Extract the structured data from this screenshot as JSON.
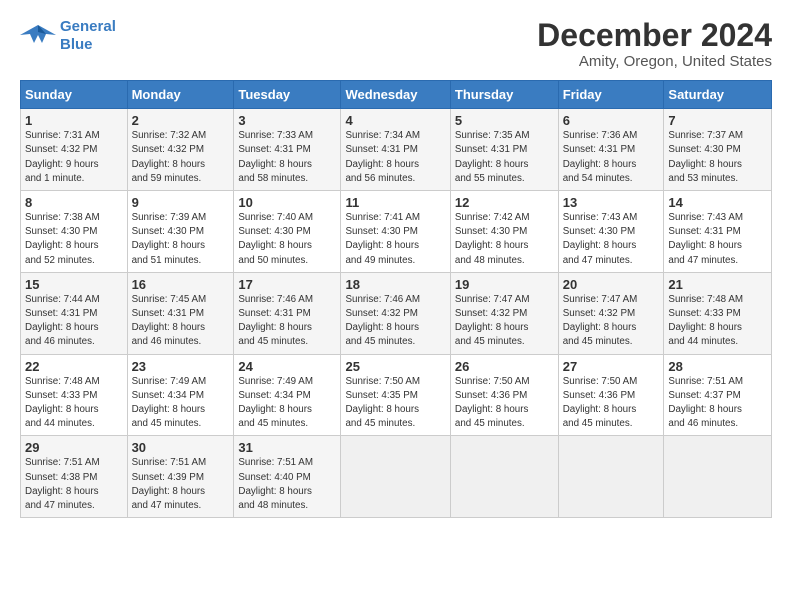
{
  "logo": {
    "line1": "General",
    "line2": "Blue"
  },
  "title": "December 2024",
  "subtitle": "Amity, Oregon, United States",
  "days_of_week": [
    "Sunday",
    "Monday",
    "Tuesday",
    "Wednesday",
    "Thursday",
    "Friday",
    "Saturday"
  ],
  "weeks": [
    [
      {
        "day": 1,
        "info": "Sunrise: 7:31 AM\nSunset: 4:32 PM\nDaylight: 9 hours\nand 1 minute."
      },
      {
        "day": 2,
        "info": "Sunrise: 7:32 AM\nSunset: 4:32 PM\nDaylight: 8 hours\nand 59 minutes."
      },
      {
        "day": 3,
        "info": "Sunrise: 7:33 AM\nSunset: 4:31 PM\nDaylight: 8 hours\nand 58 minutes."
      },
      {
        "day": 4,
        "info": "Sunrise: 7:34 AM\nSunset: 4:31 PM\nDaylight: 8 hours\nand 56 minutes."
      },
      {
        "day": 5,
        "info": "Sunrise: 7:35 AM\nSunset: 4:31 PM\nDaylight: 8 hours\nand 55 minutes."
      },
      {
        "day": 6,
        "info": "Sunrise: 7:36 AM\nSunset: 4:31 PM\nDaylight: 8 hours\nand 54 minutes."
      },
      {
        "day": 7,
        "info": "Sunrise: 7:37 AM\nSunset: 4:30 PM\nDaylight: 8 hours\nand 53 minutes."
      }
    ],
    [
      {
        "day": 8,
        "info": "Sunrise: 7:38 AM\nSunset: 4:30 PM\nDaylight: 8 hours\nand 52 minutes."
      },
      {
        "day": 9,
        "info": "Sunrise: 7:39 AM\nSunset: 4:30 PM\nDaylight: 8 hours\nand 51 minutes."
      },
      {
        "day": 10,
        "info": "Sunrise: 7:40 AM\nSunset: 4:30 PM\nDaylight: 8 hours\nand 50 minutes."
      },
      {
        "day": 11,
        "info": "Sunrise: 7:41 AM\nSunset: 4:30 PM\nDaylight: 8 hours\nand 49 minutes."
      },
      {
        "day": 12,
        "info": "Sunrise: 7:42 AM\nSunset: 4:30 PM\nDaylight: 8 hours\nand 48 minutes."
      },
      {
        "day": 13,
        "info": "Sunrise: 7:43 AM\nSunset: 4:30 PM\nDaylight: 8 hours\nand 47 minutes."
      },
      {
        "day": 14,
        "info": "Sunrise: 7:43 AM\nSunset: 4:31 PM\nDaylight: 8 hours\nand 47 minutes."
      }
    ],
    [
      {
        "day": 15,
        "info": "Sunrise: 7:44 AM\nSunset: 4:31 PM\nDaylight: 8 hours\nand 46 minutes."
      },
      {
        "day": 16,
        "info": "Sunrise: 7:45 AM\nSunset: 4:31 PM\nDaylight: 8 hours\nand 46 minutes."
      },
      {
        "day": 17,
        "info": "Sunrise: 7:46 AM\nSunset: 4:31 PM\nDaylight: 8 hours\nand 45 minutes."
      },
      {
        "day": 18,
        "info": "Sunrise: 7:46 AM\nSunset: 4:32 PM\nDaylight: 8 hours\nand 45 minutes."
      },
      {
        "day": 19,
        "info": "Sunrise: 7:47 AM\nSunset: 4:32 PM\nDaylight: 8 hours\nand 45 minutes."
      },
      {
        "day": 20,
        "info": "Sunrise: 7:47 AM\nSunset: 4:32 PM\nDaylight: 8 hours\nand 45 minutes."
      },
      {
        "day": 21,
        "info": "Sunrise: 7:48 AM\nSunset: 4:33 PM\nDaylight: 8 hours\nand 44 minutes."
      }
    ],
    [
      {
        "day": 22,
        "info": "Sunrise: 7:48 AM\nSunset: 4:33 PM\nDaylight: 8 hours\nand 44 minutes."
      },
      {
        "day": 23,
        "info": "Sunrise: 7:49 AM\nSunset: 4:34 PM\nDaylight: 8 hours\nand 45 minutes."
      },
      {
        "day": 24,
        "info": "Sunrise: 7:49 AM\nSunset: 4:34 PM\nDaylight: 8 hours\nand 45 minutes."
      },
      {
        "day": 25,
        "info": "Sunrise: 7:50 AM\nSunset: 4:35 PM\nDaylight: 8 hours\nand 45 minutes."
      },
      {
        "day": 26,
        "info": "Sunrise: 7:50 AM\nSunset: 4:36 PM\nDaylight: 8 hours\nand 45 minutes."
      },
      {
        "day": 27,
        "info": "Sunrise: 7:50 AM\nSunset: 4:36 PM\nDaylight: 8 hours\nand 45 minutes."
      },
      {
        "day": 28,
        "info": "Sunrise: 7:51 AM\nSunset: 4:37 PM\nDaylight: 8 hours\nand 46 minutes."
      }
    ],
    [
      {
        "day": 29,
        "info": "Sunrise: 7:51 AM\nSunset: 4:38 PM\nDaylight: 8 hours\nand 47 minutes."
      },
      {
        "day": 30,
        "info": "Sunrise: 7:51 AM\nSunset: 4:39 PM\nDaylight: 8 hours\nand 47 minutes."
      },
      {
        "day": 31,
        "info": "Sunrise: 7:51 AM\nSunset: 4:40 PM\nDaylight: 8 hours\nand 48 minutes."
      },
      null,
      null,
      null,
      null
    ]
  ]
}
